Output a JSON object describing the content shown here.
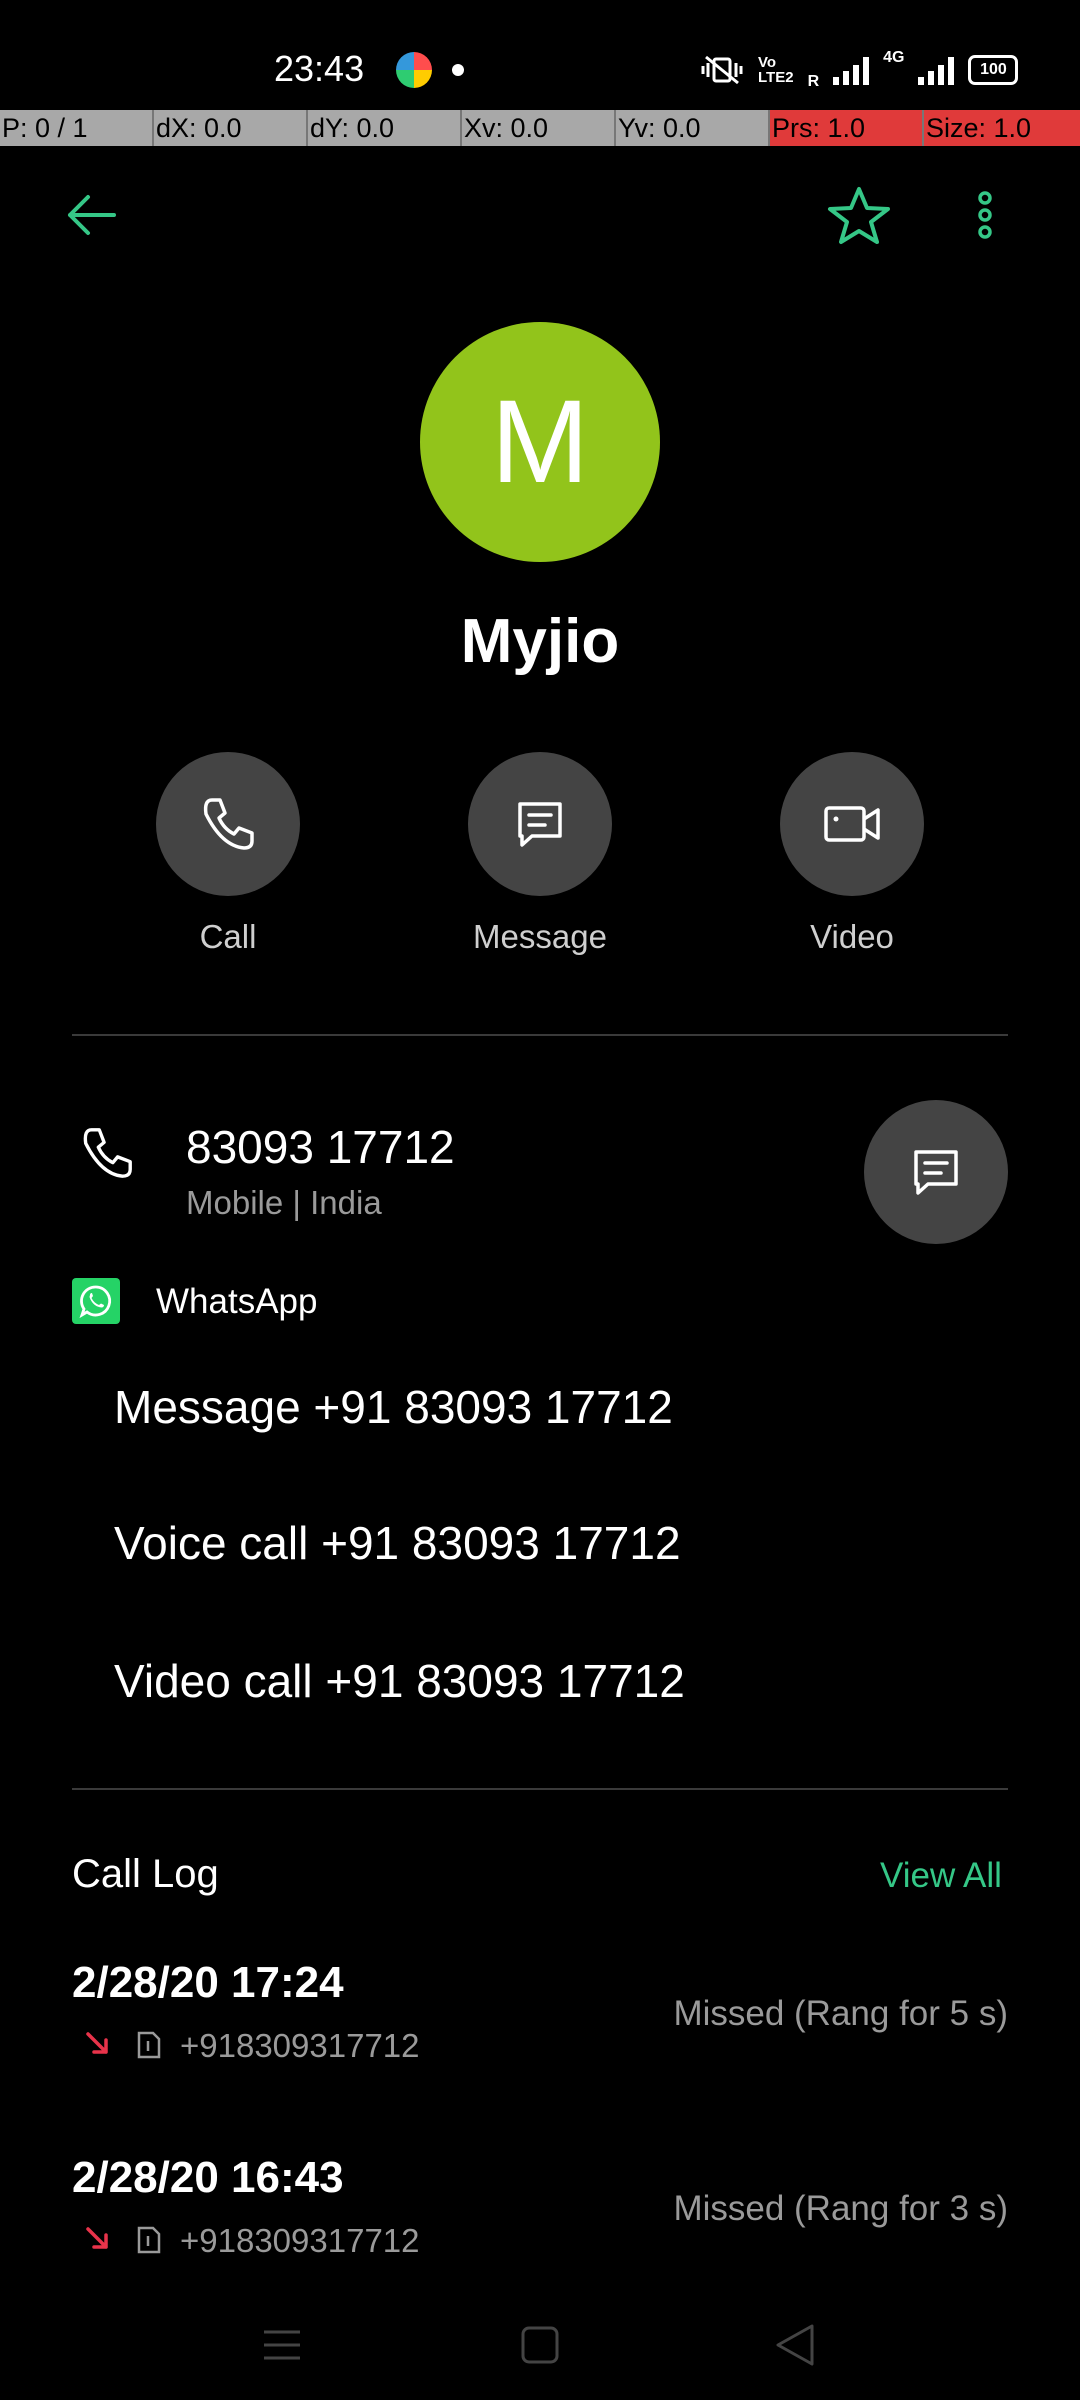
{
  "status_bar": {
    "time": "23:43",
    "network_label_1": "Vo\nLTE2",
    "roaming": "R",
    "network_type": "4G",
    "battery": "100"
  },
  "pointer_bar": [
    {
      "label": "P: 0 / 1",
      "red": false
    },
    {
      "label": "dX: 0.0",
      "red": false
    },
    {
      "label": "dY: 0.0",
      "red": false
    },
    {
      "label": "Xv: 0.0",
      "red": false
    },
    {
      "label": "Yv: 0.0",
      "red": false
    },
    {
      "label": "Prs: 1.0",
      "red": true
    },
    {
      "label": "Size: 1.0",
      "red": true
    }
  ],
  "contact": {
    "initial": "M",
    "name": "Myjio",
    "avatar_color": "#92c41b"
  },
  "actions": {
    "call": "Call",
    "message": "Message",
    "video": "Video"
  },
  "phone": {
    "number": "83093 17712",
    "meta": "Mobile | India"
  },
  "whatsapp": {
    "label": "WhatsApp",
    "message": "Message +91 83093 17712",
    "voice_call": "Voice call +91 83093 17712",
    "video_call": "Video call +91 83093 17712"
  },
  "call_log": {
    "title": "Call Log",
    "view_all": "View All",
    "entries": [
      {
        "date": "2/28/20 17:24",
        "number": "+918309317712",
        "status": "Missed (Rang for 5 s)"
      },
      {
        "date": "2/28/20 16:43",
        "number": "+918309317712",
        "status": "Missed (Rang for 3 s)"
      }
    ]
  },
  "colors": {
    "accent": "#35c787",
    "missed": "#e8334a",
    "button_bg": "#444444"
  }
}
